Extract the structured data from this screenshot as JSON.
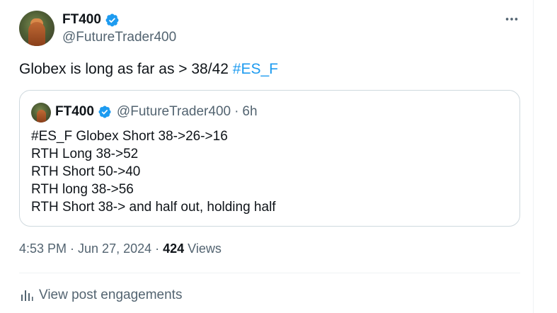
{
  "author": {
    "display_name": "FT400",
    "handle": "@FutureTrader400",
    "verified_icon": "verified-badge-icon"
  },
  "tweet": {
    "text": "Globex is long as far as > 38/42 ",
    "hashtag": "#ES_F"
  },
  "quote": {
    "display_name": "FT400",
    "handle": "@FutureTrader400",
    "separator": "·",
    "time": "6h",
    "lines": [
      "#ES_F Globex Short 38->26->16",
      "RTH Long 38->52",
      "RTH Short 50->40",
      "RTH long 38->56",
      "RTH Short 38-> and half out, holding half"
    ]
  },
  "meta": {
    "timestamp": "4:53 PM · Jun 27, 2024",
    "separator": " · ",
    "views_count": "424",
    "views_label": " Views"
  },
  "engagements": {
    "label": "View post engagements",
    "icon": "analytics-bars-icon"
  },
  "colors": {
    "accent": "#1d9bf0",
    "text": "#0f1419",
    "secondary": "#536471",
    "border": "#cfd9de"
  }
}
